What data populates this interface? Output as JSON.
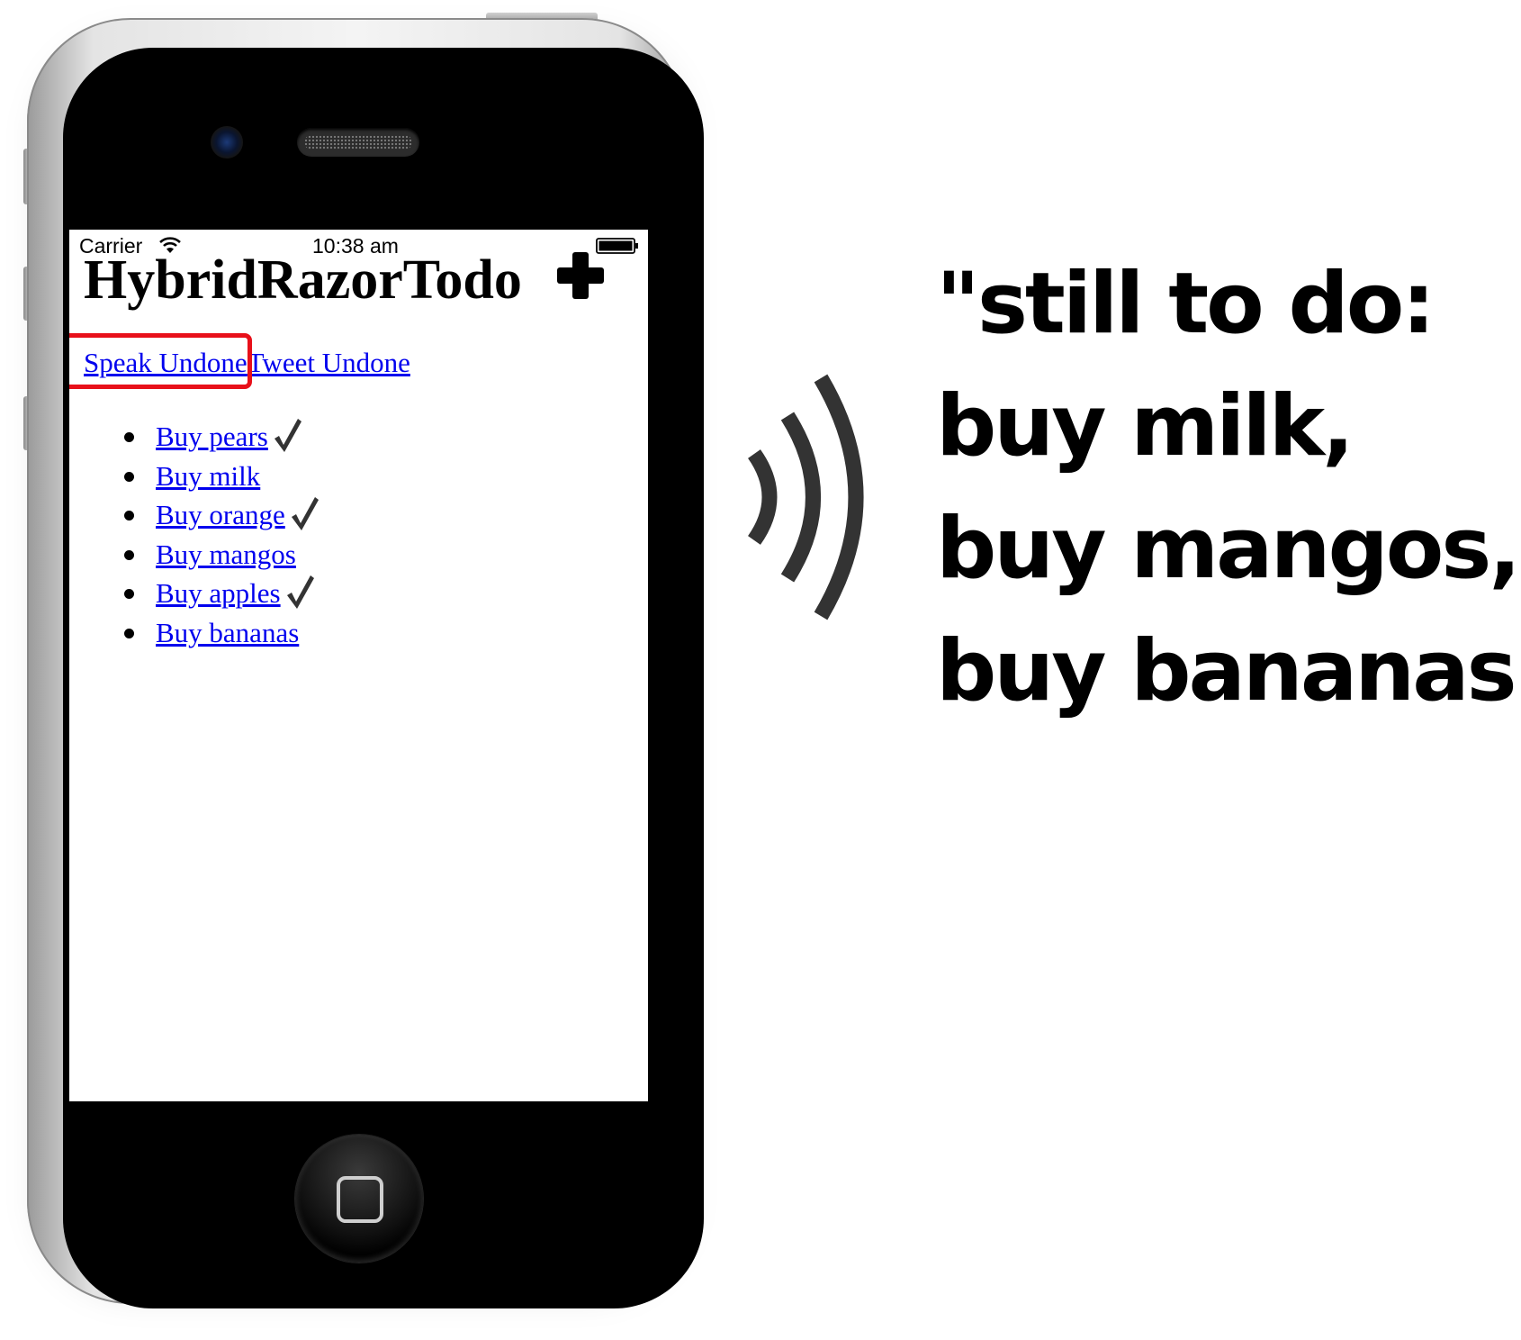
{
  "status_bar": {
    "carrier": "Carrier",
    "time": "10:38 am"
  },
  "app": {
    "title": "HybridRazorTodo",
    "add_icon": "plus-icon"
  },
  "actions": {
    "speak": "Speak Undone",
    "tweet": "Tweet Undone"
  },
  "todos": [
    {
      "label": "Buy pears",
      "done": true
    },
    {
      "label": "Buy milk",
      "done": false
    },
    {
      "label": "Buy orange",
      "done": true
    },
    {
      "label": "Buy mangos",
      "done": false
    },
    {
      "label": "Buy apples",
      "done": true
    },
    {
      "label": "Buy bananas",
      "done": false
    }
  ],
  "speech": {
    "icon": "sound-waves-icon",
    "lines": [
      "\"still to do:",
      "buy milk,",
      "buy mangos,",
      "buy bananas\""
    ]
  },
  "colors": {
    "link": "#0000ee",
    "highlight": "#e8101a",
    "check": "#333333",
    "sound_waves": "#333333"
  }
}
